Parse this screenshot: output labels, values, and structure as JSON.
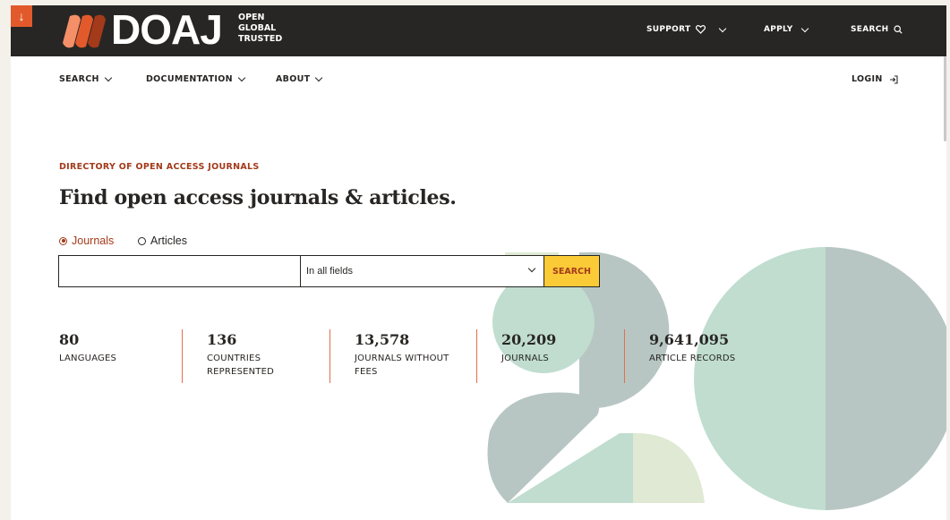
{
  "header": {
    "logo_word": "DOAJ",
    "logo_tagline": [
      "OPEN",
      "GLOBAL",
      "TRUSTED"
    ],
    "nav": [
      {
        "label": "SUPPORT",
        "icon": "heart-icon",
        "dropdown": true
      },
      {
        "label": "APPLY",
        "dropdown": true
      },
      {
        "label": "SEARCH",
        "icon": "search-icon"
      }
    ]
  },
  "subnav": {
    "items": [
      "SEARCH",
      "DOCUMENTATION",
      "ABOUT"
    ],
    "login": "LOGIN"
  },
  "hero": {
    "kicker": "DIRECTORY OF OPEN ACCESS JOURNALS",
    "headline": "Find open access journals & articles.",
    "radio_options": [
      {
        "label": "Journals",
        "selected": true
      },
      {
        "label": "Articles",
        "selected": false
      }
    ],
    "search": {
      "value": "",
      "field_select": "In all fields",
      "button_label": "SEARCH"
    }
  },
  "stats": [
    {
      "value": "80",
      "label": "LANGUAGES"
    },
    {
      "value": "136",
      "label": "COUNTRIES REPRESENTED"
    },
    {
      "value": "13,578",
      "label": "JOURNALS WITHOUT FEES"
    },
    {
      "value": "20,209",
      "label": "JOURNALS"
    },
    {
      "value": "9,641,095",
      "label": "ARTICLE RECORDS"
    }
  ],
  "colors": {
    "dark": "#282624",
    "accent_red": "#a33a1a",
    "skip_orange": "#e25a2b",
    "search_yellow": "#fbcb37",
    "mint": "#c0ddd0",
    "grey_green": "#b7c6c3",
    "pale_green": "#dfe9d3"
  }
}
